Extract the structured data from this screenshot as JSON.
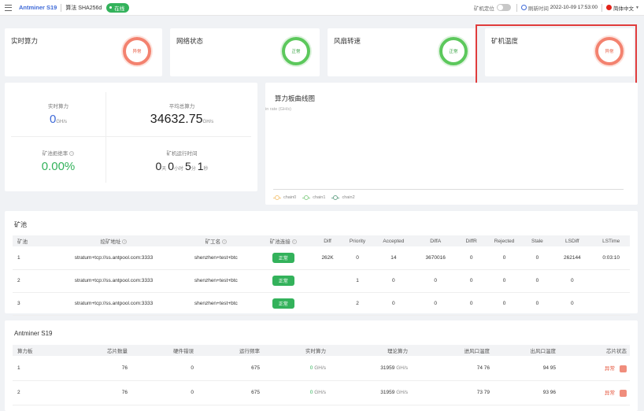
{
  "header": {
    "brand": "Antminer S19",
    "algo": "算法 SHA256d",
    "status": "在线",
    "locate_label": "矿机定位",
    "refresh_label": "刷新时间",
    "refresh_time": "2022-10-09 17:53:00",
    "language": "简体中文"
  },
  "stat_cards": [
    {
      "title": "实时算力",
      "ring": "异常",
      "color": "#f3826f"
    },
    {
      "title": "网络状态",
      "ring": "正常",
      "color": "#5cc85c"
    },
    {
      "title": "风扇转速",
      "ring": "正常",
      "color": "#5cc85c"
    },
    {
      "title": "矿机温度",
      "ring": "异常",
      "color": "#f3826f"
    }
  ],
  "summary": {
    "realtime_label": "实时算力",
    "realtime_value": "0",
    "realtime_unit": "GH/s",
    "avg_label": "平均总算力",
    "avg_value": "34632.75",
    "avg_unit": "GH/s",
    "reject_label": "矿池拒绝率",
    "reject_value": "0.00%",
    "uptime_label": "矿机运行时间",
    "uptime_d": "0",
    "uptime_d_unit": "天",
    "uptime_h": "0",
    "uptime_h_unit": "小时",
    "uptime_m": "5",
    "uptime_m_unit": "分",
    "uptime_s": "1",
    "uptime_s_unit": "秒"
  },
  "chart": {
    "title": "算力板曲线图",
    "ylabel": "in rate (GH/s)",
    "legend": [
      {
        "name": "chain0",
        "color": "#f5c77e"
      },
      {
        "name": "chain1",
        "color": "#8fd18f"
      },
      {
        "name": "chain2",
        "color": "#6fa88f"
      }
    ]
  },
  "pool": {
    "title": "矿池",
    "headers": [
      "矿池",
      "挖矿地址",
      "矿工名",
      "矿池连接",
      "Diff",
      "Priority",
      "Accepted",
      "DiffA",
      "DiffR",
      "Rejected",
      "Stale",
      "LSDiff",
      "LSTime"
    ],
    "rows": [
      {
        "id": "1",
        "url": "stratum+tcp://ss.antpool.com:3333",
        "worker": "shenzhen+test+btc",
        "status": "正常",
        "diff": "262K",
        "priority": "0",
        "accepted": "14",
        "diffa": "3670016",
        "diffr": "0",
        "rejected": "0",
        "stale": "0",
        "lsdiff": "262144",
        "lstime": "0:03:10"
      },
      {
        "id": "2",
        "url": "stratum+tcp://ss.antpool.com:3333",
        "worker": "shenzhen+test+btc",
        "status": "正常",
        "diff": "",
        "priority": "1",
        "accepted": "0",
        "diffa": "0",
        "diffr": "0",
        "rejected": "0",
        "stale": "0",
        "lsdiff": "0",
        "lstime": ""
      },
      {
        "id": "3",
        "url": "stratum+tcp://ss.antpool.com:3333",
        "worker": "shenzhen+test+btc",
        "status": "正常",
        "diff": "",
        "priority": "2",
        "accepted": "0",
        "diffa": "0",
        "diffr": "0",
        "rejected": "0",
        "stale": "0",
        "lsdiff": "0",
        "lstime": ""
      }
    ]
  },
  "boards": {
    "title": "Antminer S19",
    "headers": [
      "算力板",
      "芯片数量",
      "硬件错误",
      "运行频率",
      "实时算力",
      "理论算力",
      "进风口温度",
      "出风口温度",
      "芯片状态"
    ],
    "rows": [
      {
        "id": "1",
        "chips": "76",
        "hw": "0",
        "freq": "675",
        "rt": "0",
        "rt_unit": "GH/s",
        "theory": "31959",
        "theory_unit": "GH/s",
        "inlet": "74 76",
        "outlet": "94 95",
        "state": "异常"
      },
      {
        "id": "2",
        "chips": "76",
        "hw": "0",
        "freq": "675",
        "rt": "0",
        "rt_unit": "GH/s",
        "theory": "31959",
        "theory_unit": "GH/s",
        "inlet": "73 79",
        "outlet": "93 96",
        "state": "异常"
      }
    ]
  }
}
